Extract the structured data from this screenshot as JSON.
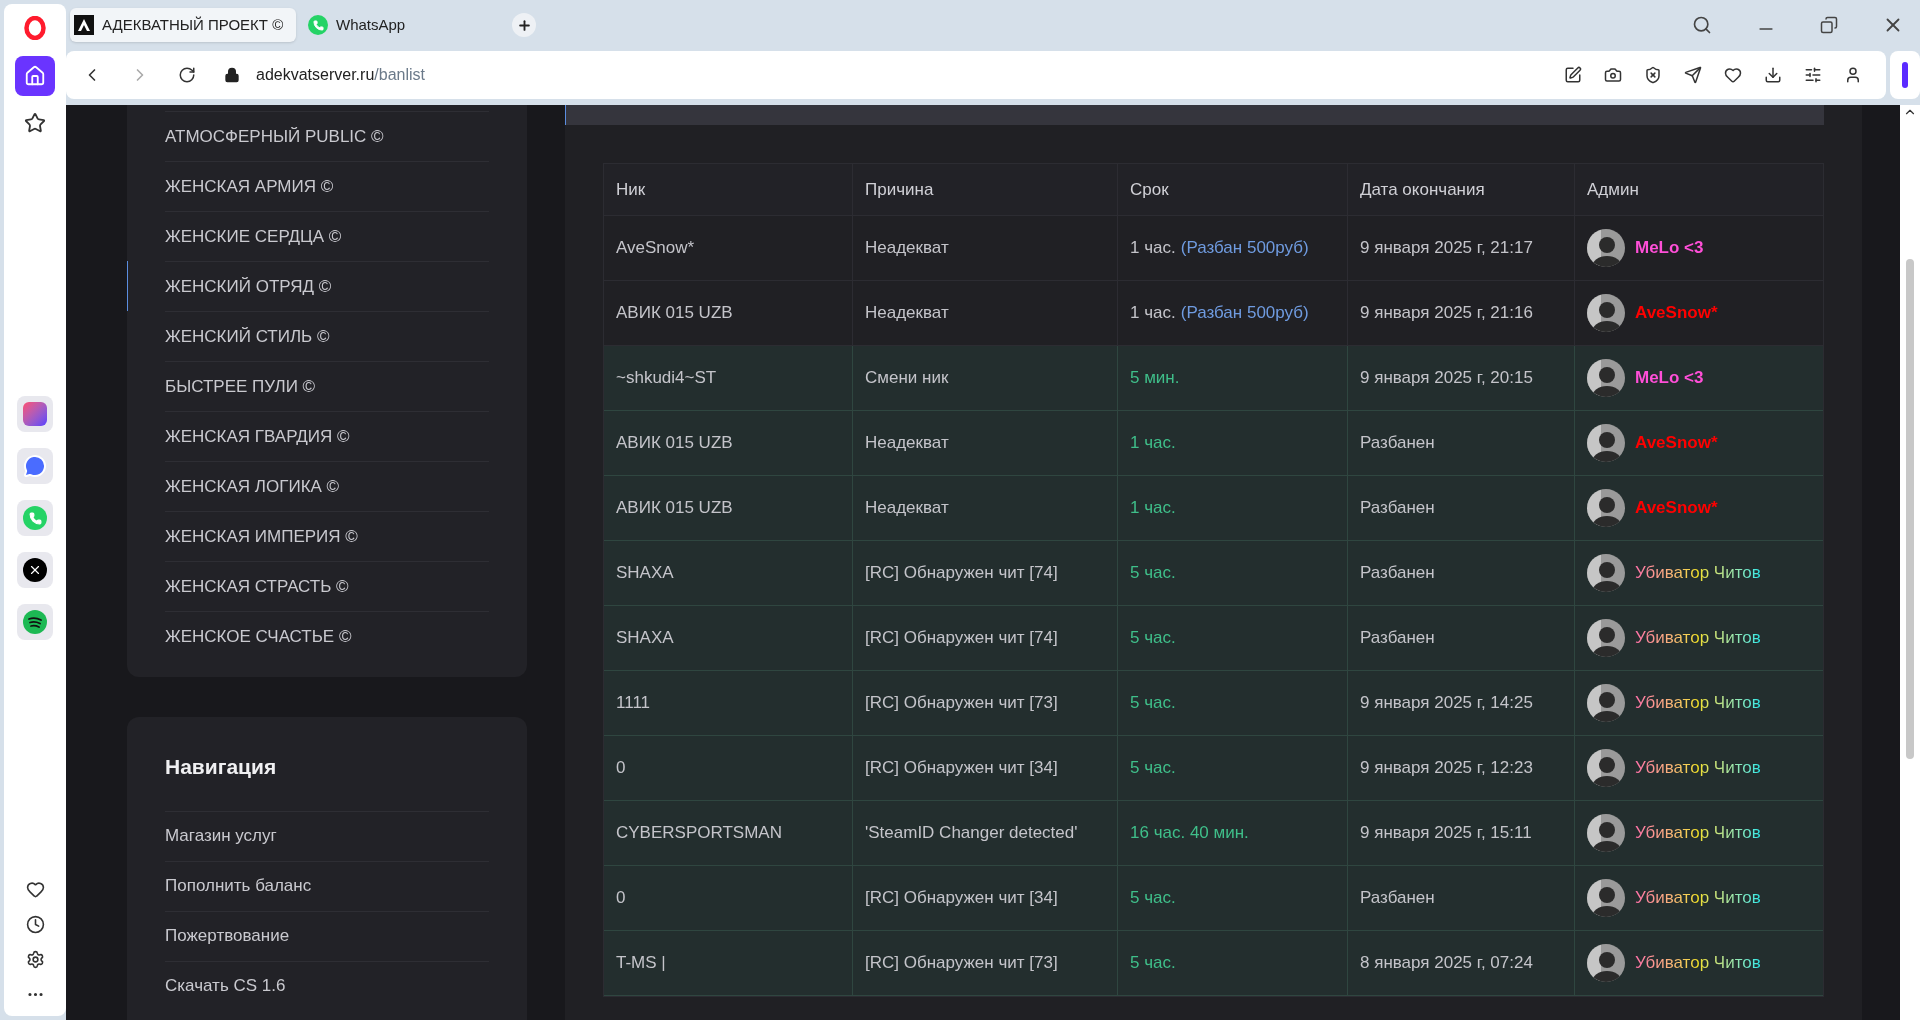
{
  "browser": {
    "tabs": [
      {
        "title": "АДЕКВАТНЫЙ ПРОЕКТ ©",
        "kind": "site",
        "selected": true
      },
      {
        "title": "WhatsApp",
        "kind": "whatsapp",
        "selected": false
      }
    ],
    "address": {
      "host": "adekvatserver.ru",
      "path": "/banlist"
    },
    "forward_disabled": true
  },
  "servers": [
    {
      "label": "АТМОСФЕРНЫЙ PUBLIC ©",
      "selected": false
    },
    {
      "label": "ЖЕНСКАЯ АРМИЯ ©",
      "selected": false
    },
    {
      "label": "ЖЕНСКИЕ СЕРДЦА ©",
      "selected": false
    },
    {
      "label": "ЖЕНСКИЙ ОТРЯД ©",
      "selected": true
    },
    {
      "label": "ЖЕНСКИЙ СТИЛЬ ©",
      "selected": false
    },
    {
      "label": "БЫСТРЕЕ ПУЛИ ©",
      "selected": false
    },
    {
      "label": "ЖЕНСКАЯ ГВАРДИЯ ©",
      "selected": false
    },
    {
      "label": "ЖЕНСКАЯ ЛОГИКА ©",
      "selected": false
    },
    {
      "label": "ЖЕНСКАЯ ИМПЕРИЯ ©",
      "selected": false
    },
    {
      "label": "ЖЕНСКАЯ СТРАСТЬ ©",
      "selected": false
    },
    {
      "label": "ЖЕНСКОЕ СЧАСТЬЕ ©",
      "selected": false
    }
  ],
  "navigation": {
    "title": "Навигация",
    "items": [
      "Магазин услуг",
      "Пополнить баланс",
      "Пожертвование",
      "Скачать CS 1.6"
    ]
  },
  "banlist": {
    "columns": [
      "Ник",
      "Причина",
      "Срок",
      "Дата окончания",
      "Админ"
    ],
    "rows": [
      {
        "nick": "AveSnow*",
        "reason": "Неадекват",
        "term": "1 час.",
        "unban_link": "(Разбан 500руб)",
        "expires": "9 января 2025 г, 21:17",
        "expired": false,
        "admin": {
          "name": "MeLo <3",
          "kind": "solid",
          "color": "#ff4fd8"
        }
      },
      {
        "nick": "АВИК 015 UZB",
        "reason": "Неадекват",
        "term": "1 час.",
        "unban_link": "(Разбан 500руб)",
        "expires": "9 января 2025 г, 21:16",
        "expired": false,
        "admin": {
          "name": "AveSnow*",
          "kind": "solid",
          "color": "#ff0000"
        }
      },
      {
        "nick": "~shkudi4~ST",
        "reason": "Смени ник",
        "term": "5 мин.",
        "expires": "9 января 2025 г, 20:15",
        "expired": true,
        "admin": {
          "name": "MeLo <3",
          "kind": "solid",
          "color": "#ff4fd8"
        }
      },
      {
        "nick": "АВИК 015 UZB",
        "reason": "Неадекват",
        "term": "1 час.",
        "expires": "Разбанен",
        "expired": true,
        "admin": {
          "name": "AveSnow*",
          "kind": "solid",
          "color": "#ff0000"
        }
      },
      {
        "nick": "АВИК 015 UZB",
        "reason": "Неадекват",
        "term": "1 час.",
        "expires": "Разбанен",
        "expired": true,
        "admin": {
          "name": "AveSnow*",
          "kind": "solid",
          "color": "#ff0000"
        }
      },
      {
        "nick": "SHAXA",
        "reason": "[RC] Обнаружен чит [74]",
        "term": "5 час.",
        "expires": "Разбанен",
        "expired": true,
        "admin": {
          "name": "Убиватор Читов",
          "kind": "gradient"
        }
      },
      {
        "nick": "SHAXA",
        "reason": "[RC] Обнаружен чит [74]",
        "term": "5 час.",
        "expires": "Разбанен",
        "expired": true,
        "admin": {
          "name": "Убиватор Читов",
          "kind": "gradient"
        }
      },
      {
        "nick": "1111",
        "reason": "[RC] Обнаружен чит [73]",
        "term": "5 час.",
        "expires": "9 января 2025 г, 14:25",
        "expired": true,
        "admin": {
          "name": "Убиватор Читов",
          "kind": "gradient"
        }
      },
      {
        "nick": "0",
        "reason": "[RC] Обнаружен чит [34]",
        "term": "5 час.",
        "expires": "9 января 2025 г, 12:23",
        "expired": true,
        "admin": {
          "name": "Убиватор Читов",
          "kind": "gradient"
        }
      },
      {
        "nick": "CYBERSPORTSMAN",
        "reason": "'SteamID Changer detected'",
        "term": "16 час. 40 мин.",
        "expires": "9 января 2025 г, 15:11",
        "expired": true,
        "admin": {
          "name": "Убиватор Читов",
          "kind": "gradient"
        }
      },
      {
        "nick": "0",
        "reason": "[RC] Обнаружен чит [34]",
        "term": "5 час.",
        "expires": "Разбанен",
        "expired": true,
        "admin": {
          "name": "Убиватор Читов",
          "kind": "gradient"
        }
      },
      {
        "nick": "T-MS |",
        "reason": "[RC] Обнаружен чит [73]",
        "term": "5 час.",
        "expires": "8 января 2025 г, 07:24",
        "expired": true,
        "admin": {
          "name": "Убиватор Читов",
          "kind": "gradient"
        }
      }
    ]
  }
}
